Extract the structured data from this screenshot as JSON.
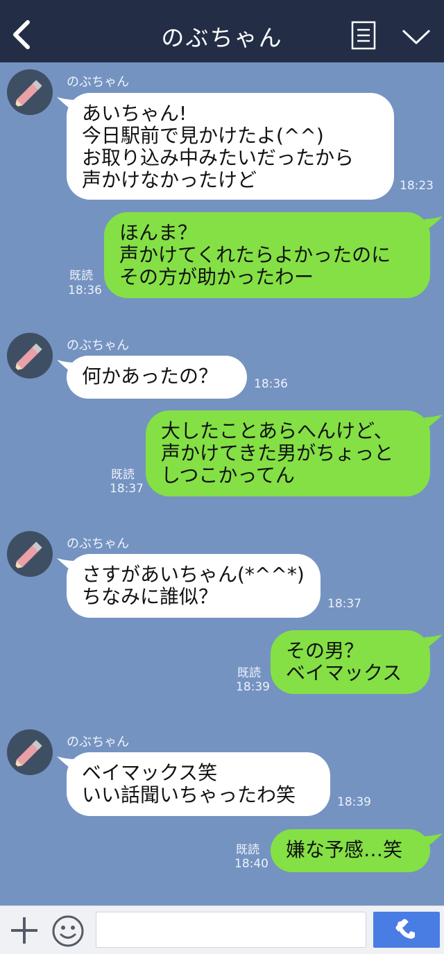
{
  "header": {
    "title": "のぶちゃん"
  },
  "messages": [
    {
      "sender": "のぶちゃん",
      "text": "あいちゃん!\n今日駅前で見かけたよ(^^)\nお取り込み中みたいだったから\n声かけなかったけど",
      "time": "18:23"
    },
    {
      "text": "ほんま？\n声かけてくれたらよかったのに\nその方が助かったわー",
      "read": "既読",
      "time": "18:36"
    },
    {
      "sender": "のぶちゃん",
      "text": "何かあったの？",
      "time": "18:36"
    },
    {
      "text": "大したことあらへんけど、\n声かけてきた男がちょっと\nしつこかってん",
      "read": "既読",
      "time": "18:37"
    },
    {
      "sender": "のぶちゃん",
      "text": "さすがあいちゃん(*^^*)\nちなみに誰似？",
      "time": "18:37"
    },
    {
      "text": "その男？\nベイマックス",
      "read": "既読",
      "time": "18:39"
    },
    {
      "sender": "のぶちゃん",
      "text": "ベイマックス笑\nいい話聞いちゃったわ笑",
      "time": "18:39"
    },
    {
      "text": "嫌な予感…笑",
      "read": "既読",
      "time": "18:40"
    }
  ],
  "footer": {
    "input_placeholder": ""
  },
  "colors": {
    "background": "#7493c1",
    "header": "#232d45",
    "incoming_bubble": "#ffffff",
    "outgoing_bubble": "#84e045",
    "call_button": "#4a7de3"
  },
  "icons": [
    "back-arrow-icon",
    "menu-list-icon",
    "chevron-down-icon",
    "pencil-avatar-icon",
    "plus-icon",
    "smiley-icon",
    "phone-icon"
  ]
}
